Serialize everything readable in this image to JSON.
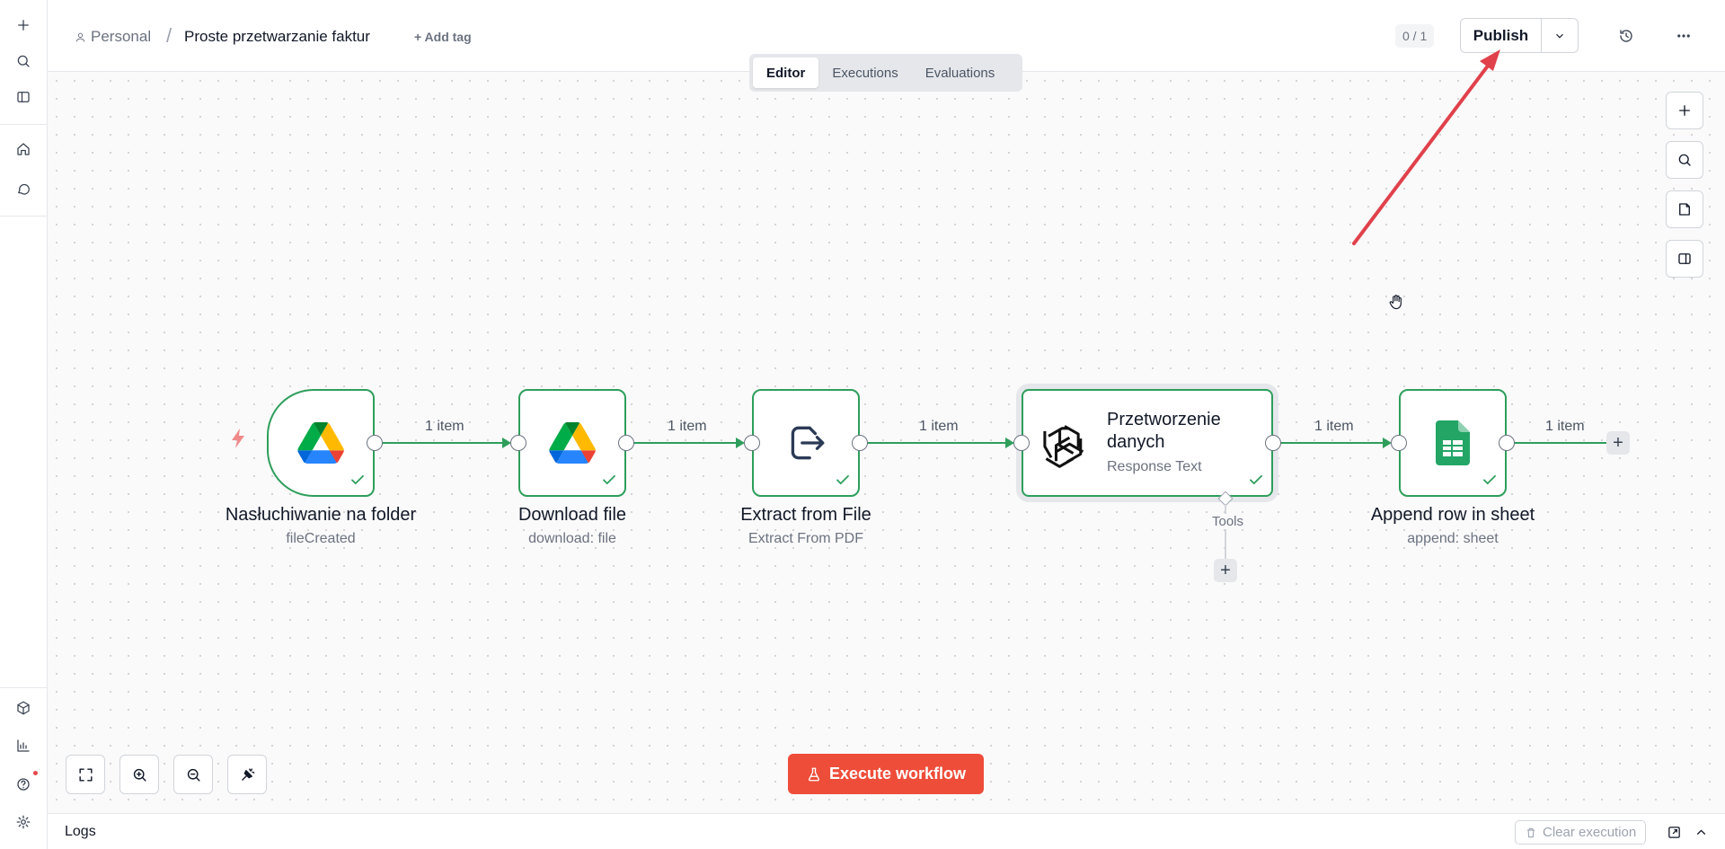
{
  "breadcrumb": {
    "project": "Personal",
    "separator": "/",
    "workflow_name": "Proste przetwarzanie faktur"
  },
  "header": {
    "add_tag": "+ Add tag",
    "version_counter": "0 / 1",
    "publish_label": "Publish"
  },
  "tabs": [
    {
      "label": "Editor",
      "active": true
    },
    {
      "label": "Executions",
      "active": false
    },
    {
      "label": "Evaluations",
      "active": false
    }
  ],
  "nodes": [
    {
      "title": "Nasłuchiwanie na folder",
      "subtitle": "fileCreated",
      "icon": "google-drive-icon"
    },
    {
      "title": "Download file",
      "subtitle": "download: file",
      "icon": "google-drive-icon"
    },
    {
      "title": "Extract from File",
      "subtitle": "Extract From PDF",
      "icon": "file-export-icon"
    },
    {
      "title": "Przetworzenie danych",
      "subtitle": "Response Text",
      "icon": "openai-icon"
    },
    {
      "title": "Append row in sheet",
      "subtitle": "append: sheet",
      "icon": "google-sheets-icon"
    }
  ],
  "edges": {
    "label": "1 item"
  },
  "tools_label": "Tools",
  "execute_button": "Execute workflow",
  "logs": {
    "label": "Logs",
    "clear_execution": "Clear execution"
  },
  "colors": {
    "success_green": "#2e9e5b",
    "execute_orange": "#ee4d3a",
    "annotation_red": "#e0414b"
  }
}
